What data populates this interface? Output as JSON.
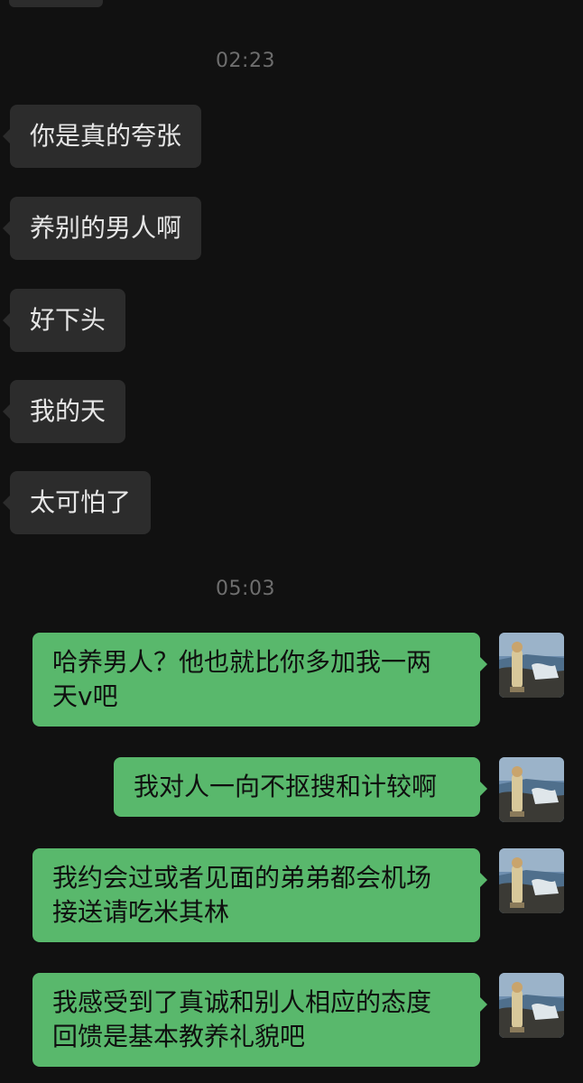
{
  "chat": {
    "timestamps": [
      "02:23",
      "05:03"
    ],
    "incoming": [
      {
        "text": "你是真的夸张"
      },
      {
        "text": "养别的男人啊"
      },
      {
        "text": "好下头"
      },
      {
        "text": "我的天"
      },
      {
        "text": "太可怕了"
      }
    ],
    "outgoing": [
      {
        "line1": "哈养男人？他也就比你多加我一两",
        "line2": "天v吧"
      },
      {
        "line1": "我对人一向不抠搜和计较啊"
      },
      {
        "line1": "我约会过或者见面的弟弟都会机场",
        "line2": "接送请吃米其林"
      },
      {
        "line1": "我感受到了真诚和别人相应的态度",
        "line2": "回馈是基本教养礼貌吧"
      }
    ],
    "colors": {
      "background": "#111111",
      "incoming_bubble": "#2c2c2c",
      "outgoing_bubble": "#59b86c",
      "timestamp": "#6e6e6e"
    },
    "icons": {
      "avatar": "user-avatar-landscape-photo"
    }
  }
}
